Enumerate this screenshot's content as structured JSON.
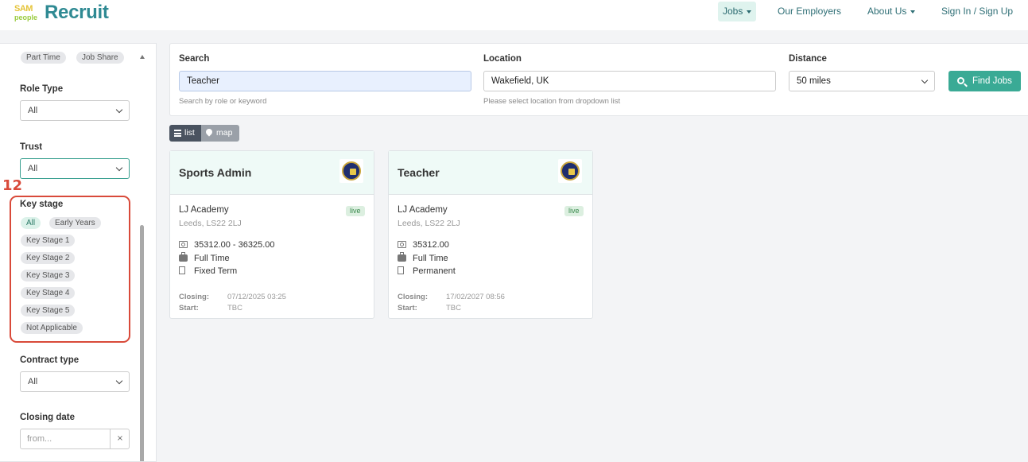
{
  "header": {
    "logo_sam": "SAM",
    "logo_people": "people",
    "logo_text": "Recruit",
    "nav": [
      {
        "label": "Jobs"
      },
      {
        "label": "Our Employers"
      },
      {
        "label": "About Us"
      },
      {
        "label": "Sign In / Sign Up"
      }
    ]
  },
  "sidebar": {
    "top_chips": [
      "Part Time",
      "Job Share"
    ],
    "role_type": {
      "label": "Role Type",
      "value": "All"
    },
    "trust": {
      "label": "Trust",
      "value": "All"
    },
    "annotation_number": "12",
    "key_stage": {
      "label": "Key stage",
      "options": [
        "All",
        "Early Years",
        "Key Stage 1",
        "Key Stage 2",
        "Key Stage 3",
        "Key Stage 4",
        "Key Stage 5",
        "Not Applicable"
      ],
      "selected": "All"
    },
    "contract_type": {
      "label": "Contract type",
      "value": "All"
    },
    "closing_date": {
      "label": "Closing date",
      "placeholder": "from...",
      "clear": "×"
    }
  },
  "search": {
    "search_label": "Search",
    "search_value": "Teacher",
    "search_help": "Search by role or keyword",
    "location_label": "Location",
    "location_value": "Wakefield, UK",
    "location_help": "Please select location from dropdown list",
    "distance_label": "Distance",
    "distance_value": "50 miles",
    "find_button": "Find Jobs"
  },
  "view_toggle": {
    "list": "list",
    "map": "map",
    "active": "list"
  },
  "jobs": [
    {
      "title": "Sports Admin",
      "employer": "LJ Academy",
      "address": "Leeds, LS22 2LJ",
      "status": "live",
      "salary": "35312.00 - 36325.00",
      "hours": "Full Time",
      "contract": "Fixed Term",
      "closing_label": "Closing:",
      "closing": "07/12/2025 03:25",
      "start_label": "Start:",
      "start": "TBC"
    },
    {
      "title": "Teacher",
      "employer": "LJ Academy",
      "address": "Leeds, LS22 2LJ",
      "status": "live",
      "salary": "35312.00",
      "hours": "Full Time",
      "contract": "Permanent",
      "closing_label": "Closing:",
      "closing": "17/02/2027 08:56",
      "start_label": "Start:",
      "start": "TBC"
    }
  ],
  "colors": {
    "brand_teal": "#2f8a93",
    "button_green": "#3aaa95",
    "highlight_red": "#d94a3a",
    "card_header": "#effaf7"
  }
}
